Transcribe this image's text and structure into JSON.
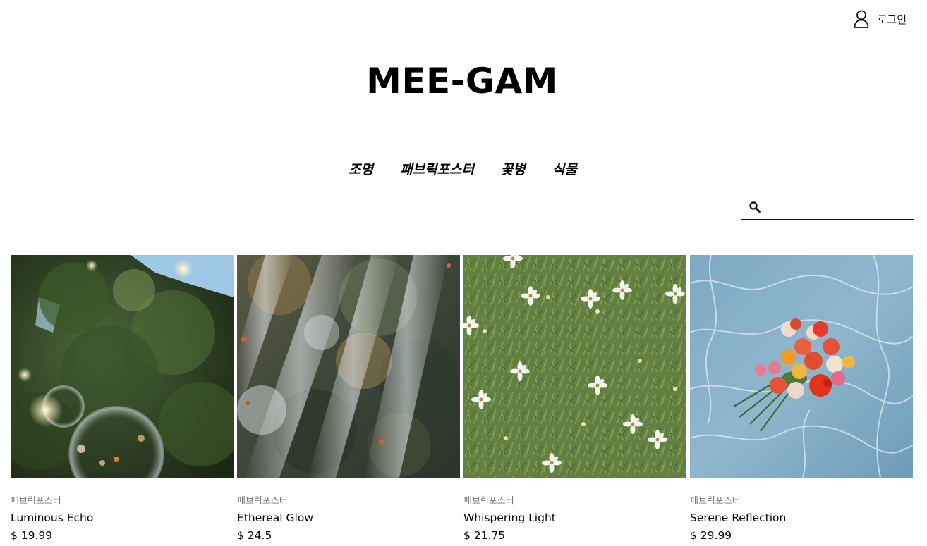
{
  "header": {
    "login_label": "로그인",
    "logo": "MEE-GAM"
  },
  "nav": {
    "items": [
      {
        "label": "조명"
      },
      {
        "label": "패브릭포스터"
      },
      {
        "label": "꽃병"
      },
      {
        "label": "식물"
      }
    ]
  },
  "search": {
    "value": "",
    "placeholder": "",
    "icon": "search-icon"
  },
  "products": [
    {
      "category": "패브릭포스터",
      "name": "Luminous Echo",
      "price": "$ 19.99",
      "image": "sunlit green trees with soap bubbles"
    },
    {
      "category": "패브릭포스터",
      "name": "Ethereal Glow",
      "price": "$ 24.5",
      "image": "light rays through reflective foliage"
    },
    {
      "category": "패브릭포스터",
      "name": "Whispering Light",
      "price": "$ 21.75",
      "image": "green field with white star flowers"
    },
    {
      "category": "패브릭포스터",
      "name": "Serene Reflection",
      "price": "$ 29.99",
      "image": "bouquet of roses floating in pool water"
    }
  ],
  "colors": {
    "background": "#ffffff",
    "text": "#000000",
    "muted": "#777777"
  }
}
